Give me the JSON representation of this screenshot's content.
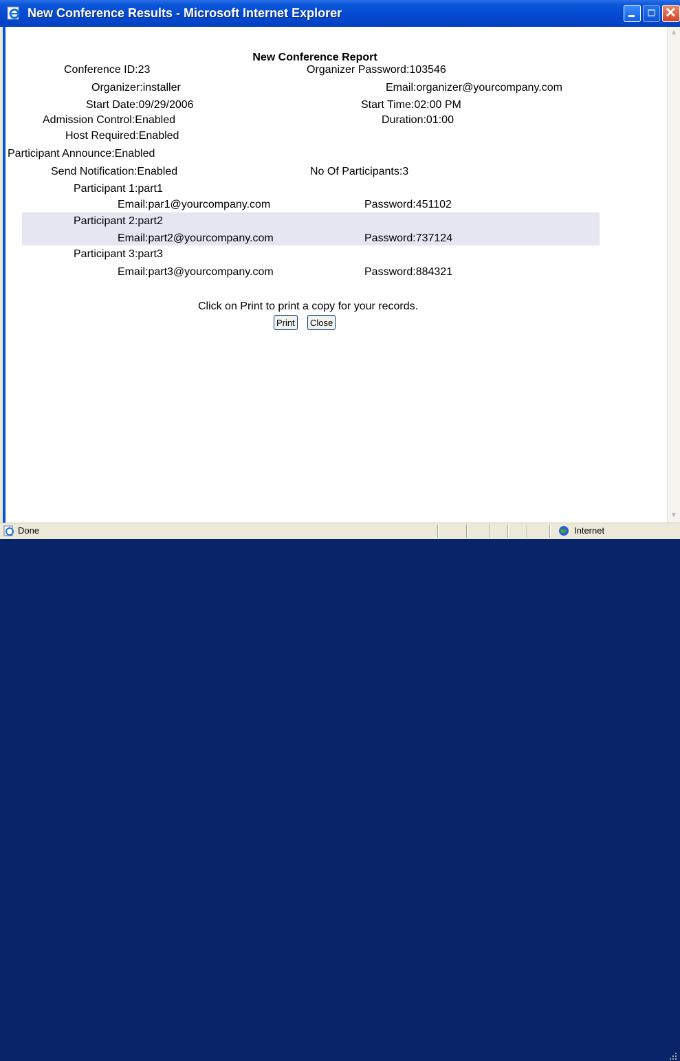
{
  "window": {
    "title": "New Conference Results - Microsoft Internet Explorer",
    "min_icon": "minimize-icon",
    "max_icon": "maximize-icon",
    "close_icon": "close-icon"
  },
  "report": {
    "heading": "New Conference Report",
    "left_fields": [
      {
        "label": "Conference ID:",
        "value": "23"
      },
      {
        "label": "Organizer:",
        "value": "installer"
      },
      {
        "label": "Start Date:",
        "value": "09/29/2006"
      },
      {
        "label": "Admission Control:",
        "value": "Enabled"
      },
      {
        "label": "Host Required:",
        "value": "Enabled"
      },
      {
        "label": "Participant Announce:",
        "value": "Enabled"
      },
      {
        "label": "Send Notification:",
        "value": "Enabled"
      }
    ],
    "right_fields": [
      {
        "label": "Organizer Password:",
        "value": "103546"
      },
      {
        "label": "Email:",
        "value": "organizer@yourcompany.com"
      },
      {
        "label": "Start Time:",
        "value": "02:00 PM"
      },
      {
        "label": "Duration:",
        "value": "01:00"
      },
      {
        "label": "No Of Participants:",
        "value": "3"
      }
    ],
    "participants": [
      {
        "label": "Participant 1:",
        "name": "part1",
        "email_label": "Email:",
        "email": "par1@yourcompany.com",
        "password_label": "Password:",
        "password": "451102"
      },
      {
        "label": "Participant 2:",
        "name": "part2",
        "email_label": "Email:",
        "email": "part2@yourcompany.com",
        "password_label": "Password:",
        "password": "737124"
      },
      {
        "label": "Participant 3:",
        "name": "part3",
        "email_label": "Email:",
        "email": "part3@yourcompany.com",
        "password_label": "Password:",
        "password": "884321"
      }
    ],
    "print_hint": "Click on Print to print a copy for your records.",
    "print_label": "Print",
    "close_label": "Close"
  },
  "statusbar": {
    "status": "Done",
    "zone": "Internet",
    "status_icon": "ie-page-icon",
    "zone_icon": "globe-icon"
  },
  "colors": {
    "titlebar": "#0448d0",
    "shaded_row": "#e5e6f2",
    "chrome": "#ece9d8"
  }
}
